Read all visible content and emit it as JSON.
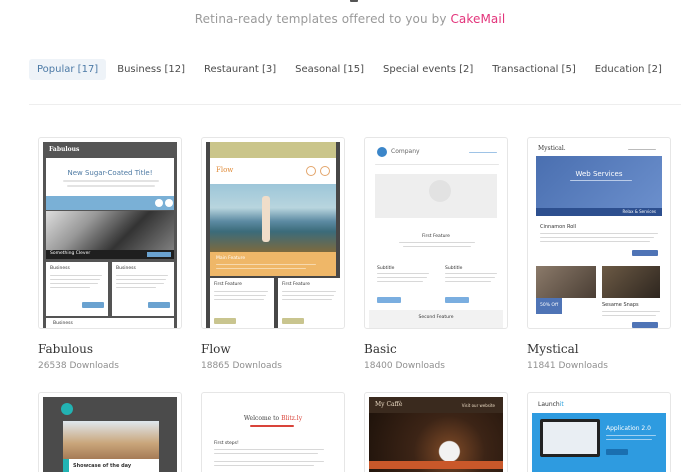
{
  "header": {
    "subtitle_prefix": "Retina-ready templates offered to you by ",
    "subtitle_brand": "CakeMail",
    "brand_color": "#e3347b"
  },
  "tabs": [
    {
      "label": "Popular [17]",
      "active": true
    },
    {
      "label": "Business [12]"
    },
    {
      "label": "Restaurant [3]"
    },
    {
      "label": "Seasonal [15]"
    },
    {
      "label": "Special events [2]"
    },
    {
      "label": "Transactional [5]"
    },
    {
      "label": "Education [2]"
    }
  ],
  "templates": [
    {
      "name": "Fabulous",
      "downloads": "26538 Downloads",
      "preview": {
        "logo": "Fabulous",
        "title": "New Sugar-Coated Title!",
        "banner": "Something Clever",
        "col1": "Business",
        "col2": "Business",
        "footer": "Business"
      }
    },
    {
      "name": "Flow",
      "downloads": "18865 Downloads",
      "preview": {
        "title": "Flow",
        "feature": "Main Feature",
        "col1": "First Feature",
        "col2": "First Feature"
      }
    },
    {
      "name": "Basic",
      "downloads": "18400 Downloads",
      "preview": {
        "logo": "Company",
        "feature1": "First Feature",
        "sub1": "Subtitle",
        "sub2": "Subtitle",
        "feature2": "Second Feature"
      }
    },
    {
      "name": "Mystical",
      "downloads": "11841 Downloads",
      "preview": {
        "logo": "Mystical.",
        "banner": "Web Services",
        "strip": "Relax & Services",
        "item": "Cinnamon Roll",
        "price": "50% Off",
        "item2": "Sesame Snaps"
      }
    }
  ],
  "row2": [
    {
      "label": "Showcase of the day"
    },
    {
      "title": "Welcome to",
      "brand": "Blitz.ly",
      "body": "First steps!"
    },
    {
      "title": "My Caffè",
      "link": "Visit our website"
    },
    {
      "title": "Launch",
      "brand": "it",
      "app": "Application 2.0"
    }
  ]
}
